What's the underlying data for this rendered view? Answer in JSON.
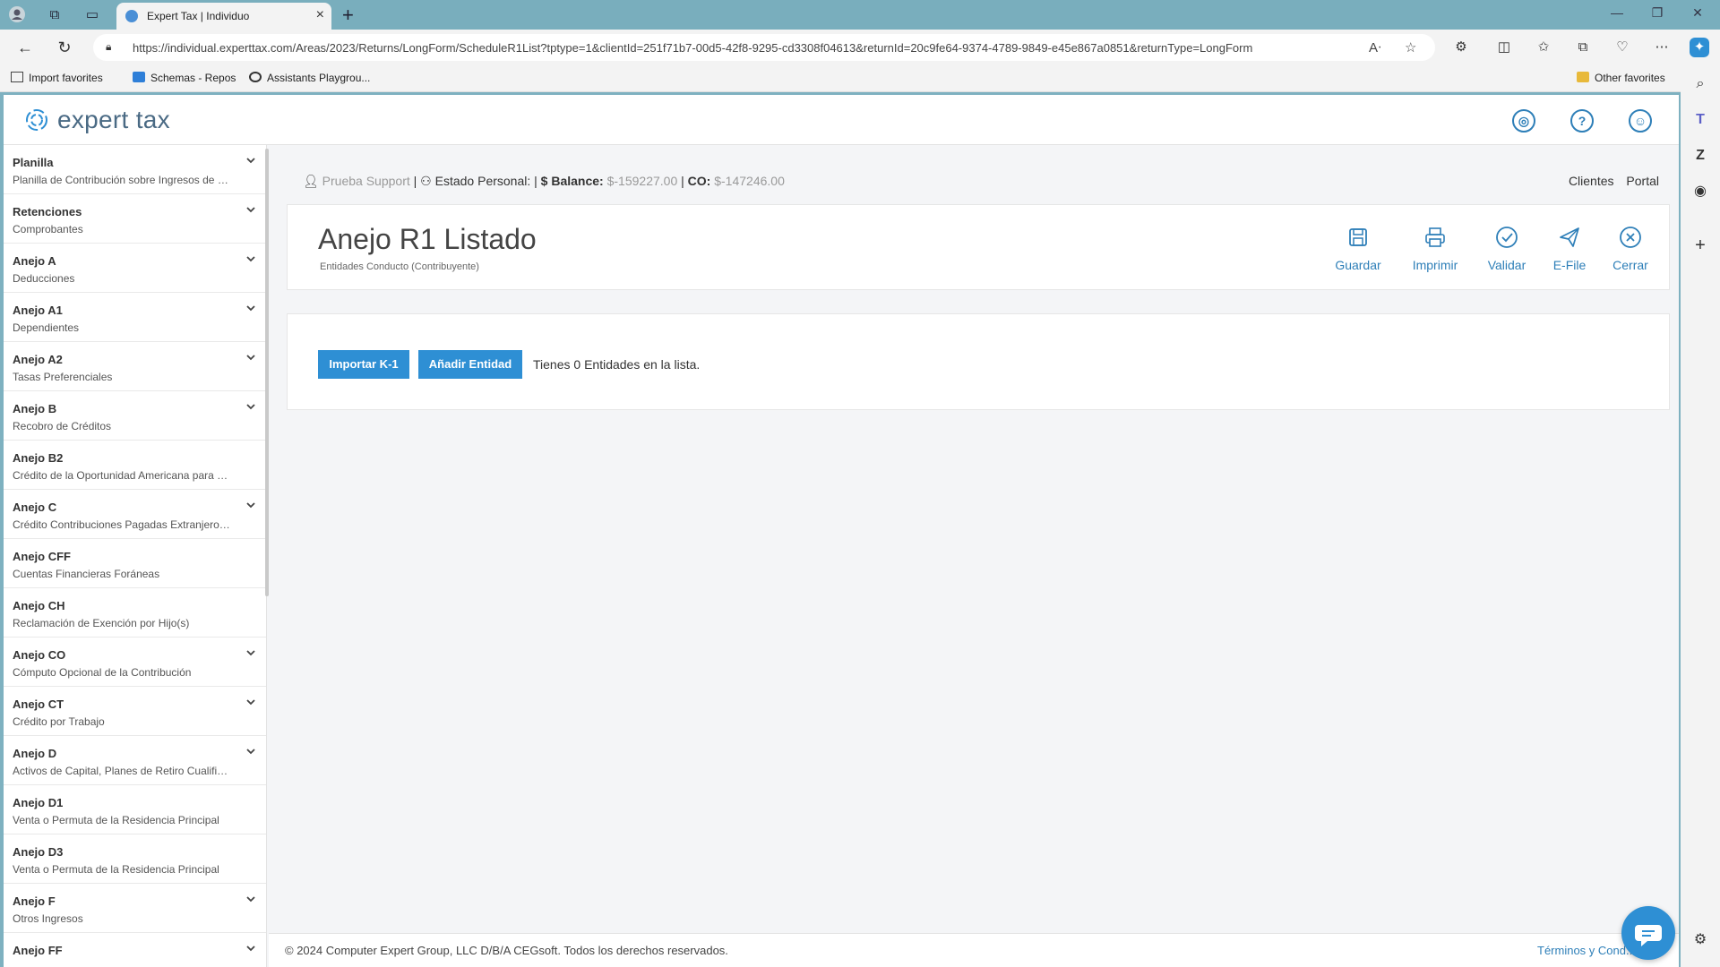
{
  "browser": {
    "tab_title": "Expert Tax | Individuo",
    "url": "https://individual.experttax.com/Areas/2023/Returns/LongForm/ScheduleR1List?tptype=1&clientId=251f71b7-00d5-42f8-9295-cd3308f04613&returnId=20c9fe64-9374-4789-9849-e45e867a0851&returnType=LongForm",
    "favorites": {
      "import": "Import favorites",
      "schemas": "Schemas - Repos",
      "assistants": "Assistants Playgrou...",
      "other": "Other favorites"
    }
  },
  "app": {
    "logo_text": "expert tax",
    "accent": "#2e8fd4"
  },
  "sidebar": {
    "items": [
      {
        "title": "Planilla",
        "subtitle": "Planilla de Contribución sobre Ingresos de Indi...",
        "chevron": true
      },
      {
        "title": "Retenciones",
        "subtitle": "Comprobantes",
        "chevron": true
      },
      {
        "title": "Anejo A",
        "subtitle": "Deducciones",
        "chevron": true
      },
      {
        "title": "Anejo A1",
        "subtitle": "Dependientes",
        "chevron": true
      },
      {
        "title": "Anejo A2",
        "subtitle": "Tasas Preferenciales",
        "chevron": true
      },
      {
        "title": "Anejo B",
        "subtitle": "Recobro de Créditos",
        "chevron": true
      },
      {
        "title": "Anejo B2",
        "subtitle": "Crédito de la Oportunidad Americana para el A...",
        "chevron": false
      },
      {
        "title": "Anejo C",
        "subtitle": "Crédito Contribuciones Pagadas Extranjero, EU",
        "chevron": true
      },
      {
        "title": "Anejo CFF",
        "subtitle": "Cuentas Financieras Foráneas",
        "chevron": false
      },
      {
        "title": "Anejo CH",
        "subtitle": "Reclamación de Exención por Hijo(s)",
        "chevron": false
      },
      {
        "title": "Anejo CO",
        "subtitle": "Cómputo Opcional de la Contribución",
        "chevron": true
      },
      {
        "title": "Anejo CT",
        "subtitle": "Crédito por Trabajo",
        "chevron": true
      },
      {
        "title": "Anejo D",
        "subtitle": "Activos de Capital, Planes de Retiro Cualificado...",
        "chevron": true
      },
      {
        "title": "Anejo D1",
        "subtitle": "Venta o Permuta de la Residencia Principal",
        "chevron": false
      },
      {
        "title": "Anejo D3",
        "subtitle": "Venta o Permuta de la Residencia Principal",
        "chevron": false
      },
      {
        "title": "Anejo F",
        "subtitle": "Otros Ingresos",
        "chevron": true
      },
      {
        "title": "Anejo FF",
        "subtitle": "",
        "chevron": true
      }
    ]
  },
  "infobar": {
    "user": "Prueba Support",
    "estado_label": "Estado Personal:",
    "balance_label": "Balance:",
    "balance_value": "$-159227.00",
    "co_label": "CO:",
    "co_value": "$-147246.00",
    "links": [
      "Clientes",
      "Portal"
    ]
  },
  "header_card": {
    "title": "Anejo R1 Listado",
    "subtitle": "Entidades Conducto (Contribuyente)",
    "actions": {
      "save": "Guardar",
      "print": "Imprimir",
      "validate": "Validar",
      "efile": "E-File",
      "close": "Cerrar"
    }
  },
  "body_card": {
    "import_button": "Importar K-1",
    "add_button": "Añadir Entidad",
    "count_text": "Tienes 0 Entidades en la lista."
  },
  "footer": {
    "copyright": "© 2024 Computer Expert Group, LLC D/B/A CEGsoft. Todos los derechos reservados.",
    "terms": "Términos y Cond..."
  }
}
